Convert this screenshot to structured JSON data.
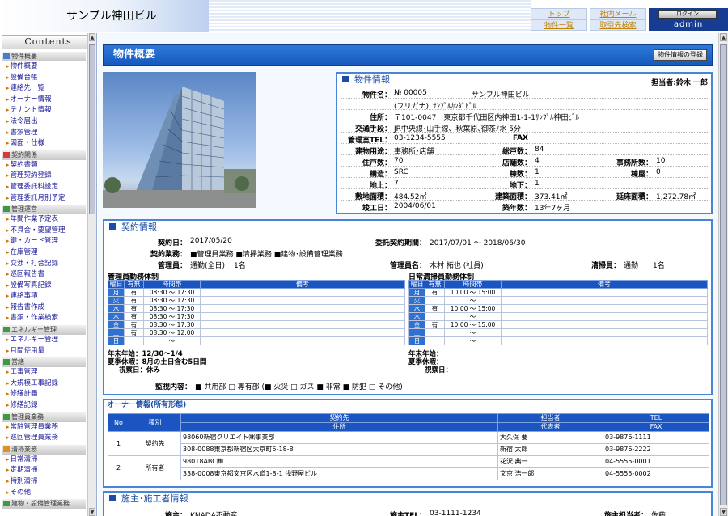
{
  "header": {
    "site_title": "サンプル神田ビル",
    "links": {
      "top": "トップ",
      "property_list": "物件一覧",
      "internal_mail": "社内メール",
      "client_search": "取引先検索"
    },
    "login_label": "ログイン",
    "user": "admin"
  },
  "sidebar": {
    "title": "Contents",
    "sections": [
      {
        "label": "物件概要",
        "color": "#4a7bd0",
        "items": [
          "物件概要",
          "設備台帳",
          "連絡先一覧",
          "オーナー情報",
          "テナント情報",
          "法令届出",
          "書類管理",
          "図面・仕様"
        ]
      },
      {
        "label": "契約関係",
        "color": "#d23b3b",
        "items": [
          "契約書類",
          "管理契約登録",
          "管理委託料設定",
          "管理委託月別予定"
        ]
      },
      {
        "label": "管理運営",
        "color": "#3f9a3f",
        "items": [
          "年間作業予定表",
          "不具合・要望管理",
          "鍵・カード管理",
          "在庫管理",
          "交渉・打合記録",
          "巡回報告書",
          "設備写真記録",
          "連絡事項",
          "報告書作成",
          "書類・作業検索"
        ]
      },
      {
        "label": "エネルギー管理",
        "color": "#3f9a3f",
        "items": [
          "エネルギー管理",
          "月間使用量"
        ]
      },
      {
        "label": "営繕",
        "color": "#3f9a3f",
        "items": [
          "工事管理",
          "大規模工事記録",
          "修繕計画",
          "修繕記録"
        ]
      },
      {
        "label": "管理員業務",
        "color": "#3f9a3f",
        "items": [
          "常駐管理員業務",
          "巡回管理員業務"
        ]
      },
      {
        "label": "清掃業務",
        "color": "#e0901e",
        "items": [
          "日常清掃",
          "定期清掃",
          "特別清掃",
          "その他"
        ]
      },
      {
        "label": "建物・設備管理業務",
        "color": "#3f9a3f",
        "items": []
      }
    ]
  },
  "page": {
    "title": "物件概要",
    "register_button": "物件情報の登録"
  },
  "property": {
    "heading": "物件情報",
    "person_in_charge": "担当者:鈴木 一郎",
    "name_label": "物件名：",
    "number": "№ 00005",
    "name": "サンプル神田ビル",
    "kana_label": "(フリガナ)",
    "kana": "ｻﾝﾌﾟﾙｶﾝﾀﾞﾋﾞﾙ",
    "address_label": "住所：",
    "address": "〒101-0047　東京都千代田区内神田1-1-1ｻﾝﾌﾟﾙ神田ﾋﾞﾙ",
    "transport_label": "交通手段：",
    "transport": "JR中央線･山手線、秋葉原､御茶ﾉ水 5分",
    "tel_label": "管理室TEL：",
    "tel": "03-1234-5555",
    "fax_label": "FAX",
    "use_label": "建物用途：",
    "use": "事務所･店舗",
    "total_units_label": "総戸数：",
    "total_units": "84",
    "residential_label": "住戸数：",
    "residential": "70",
    "shops_label": "店舗数：",
    "shops": "4",
    "offices_label": "事務所数：",
    "offices": "10",
    "structure_label": "構造：",
    "structure": "SRC",
    "buildings_label": "棟数：",
    "buildings": "1",
    "annex_label": "棟屋：",
    "annex": "0",
    "floors_above_label": "地上：",
    "floors_above": "7",
    "floors_below_label": "地下：",
    "floors_below": "1",
    "site_area_label": "敷地面積：",
    "site_area": "484.52㎡",
    "building_area_label": "建築面積：",
    "building_area": "373.41㎡",
    "floor_area_label": "延床面積：",
    "floor_area": "1,272.78㎡",
    "completion_label": "竣工日：",
    "completion": "2004/06/01",
    "age_label": "築年数：",
    "age": "13年7ヶ月"
  },
  "contract": {
    "heading": "契約情報",
    "date_label": "契約日：",
    "date": "2017/05/20",
    "period_label": "委託契約期間：",
    "period": "2017/07/01 ～ 2018/06/30",
    "services_label": "契約業務：",
    "services": "■管理員業務 ■清掃業務 ■建物･設備管理業務",
    "manager_label": "管理員：",
    "manager_type": "通勤(全日)",
    "manager_count": "1名",
    "manager_name_label": "管理員名：",
    "manager_name": "木村 拓也 (社員)",
    "cleaner_label": "清掃員：",
    "cleaner_type": "通勤",
    "cleaner_count": "1名",
    "mgr_schedule_title": "管理員勤務体制",
    "cln_schedule_title": "日常清掃員勤務体制",
    "sched_headers": [
      "曜日",
      "有無",
      "時間帯",
      "備考"
    ],
    "mgr_schedule": [
      {
        "day": "月",
        "on": "有",
        "time": "08:30 ～ 17:30"
      },
      {
        "day": "火",
        "on": "有",
        "time": "08:30 ～ 17:30"
      },
      {
        "day": "水",
        "on": "有",
        "time": "08:30 ～ 17:30"
      },
      {
        "day": "木",
        "on": "有",
        "time": "08:30 ～ 17:30"
      },
      {
        "day": "金",
        "on": "有",
        "time": "08:30 ～ 17:30"
      },
      {
        "day": "土",
        "on": "有",
        "time": "08:30 ～ 12:00"
      },
      {
        "day": "日",
        "on": "",
        "time": "～"
      }
    ],
    "cln_schedule": [
      {
        "day": "月",
        "on": "有",
        "time": "10:00 ～ 15:00"
      },
      {
        "day": "火",
        "on": "",
        "time": "～"
      },
      {
        "day": "水",
        "on": "有",
        "time": "10:00 ～ 15:00"
      },
      {
        "day": "木",
        "on": "",
        "time": "～"
      },
      {
        "day": "金",
        "on": "有",
        "time": "10:00 ～ 15:00"
      },
      {
        "day": "土",
        "on": "",
        "time": "～"
      },
      {
        "day": "日",
        "on": "",
        "time": "～"
      }
    ],
    "mgr_holidays": {
      "year_end_label": "年末年始：",
      "year_end": "12/30～1/4",
      "summer_label": "夏季休暇：",
      "summer": "8月の土日含む5日間",
      "inspection_label": "視察日：",
      "inspection": "休み"
    },
    "cln_holidays": {
      "year_end_label": "年末年始：",
      "summer_label": "夏季休暇：",
      "inspection_label": "視察日："
    },
    "monitoring_label": "監視内容：",
    "monitoring": "■ 共用部 □ 専有部 (■ 火災 □ ガス ■ 非常 ■ 防犯 □ その他)"
  },
  "owner": {
    "heading": "オーナー情報(所有形態)",
    "headers": {
      "no": "No",
      "type": "種別",
      "client": "契約先",
      "address": "住所",
      "staff": "担当者",
      "rep": "代表者",
      "tel": "TEL",
      "fax": "FAX"
    },
    "rows": [
      {
        "no": "1",
        "type": "契約先",
        "name": "98060新宿クリエイト㈱事業部",
        "address": "308-0088東京都新宿区大京町5-18-8",
        "staff": "大久保 要",
        "rep": "新宿 太郎",
        "tel": "03-9876-1111",
        "fax": "03-9876-2222"
      },
      {
        "no": "2",
        "type": "所有者",
        "name": "98018ABC㈱",
        "address": "338-0008東京都文京区水道1-8-1 浅野屋ビル",
        "staff": "花沢 典一",
        "rep": "文京 浩一郎",
        "tel": "04-5555-0001",
        "fax": "04-5555-0002"
      }
    ]
  },
  "builder": {
    "heading": "施主･施工者情報",
    "owner_label": "施主：",
    "owner": "KNADA不動産",
    "tel_label": "施主TEL：",
    "tel": "03-1111-1234",
    "staff_label": "施主担当者：",
    "staff": "佐藤"
  }
}
